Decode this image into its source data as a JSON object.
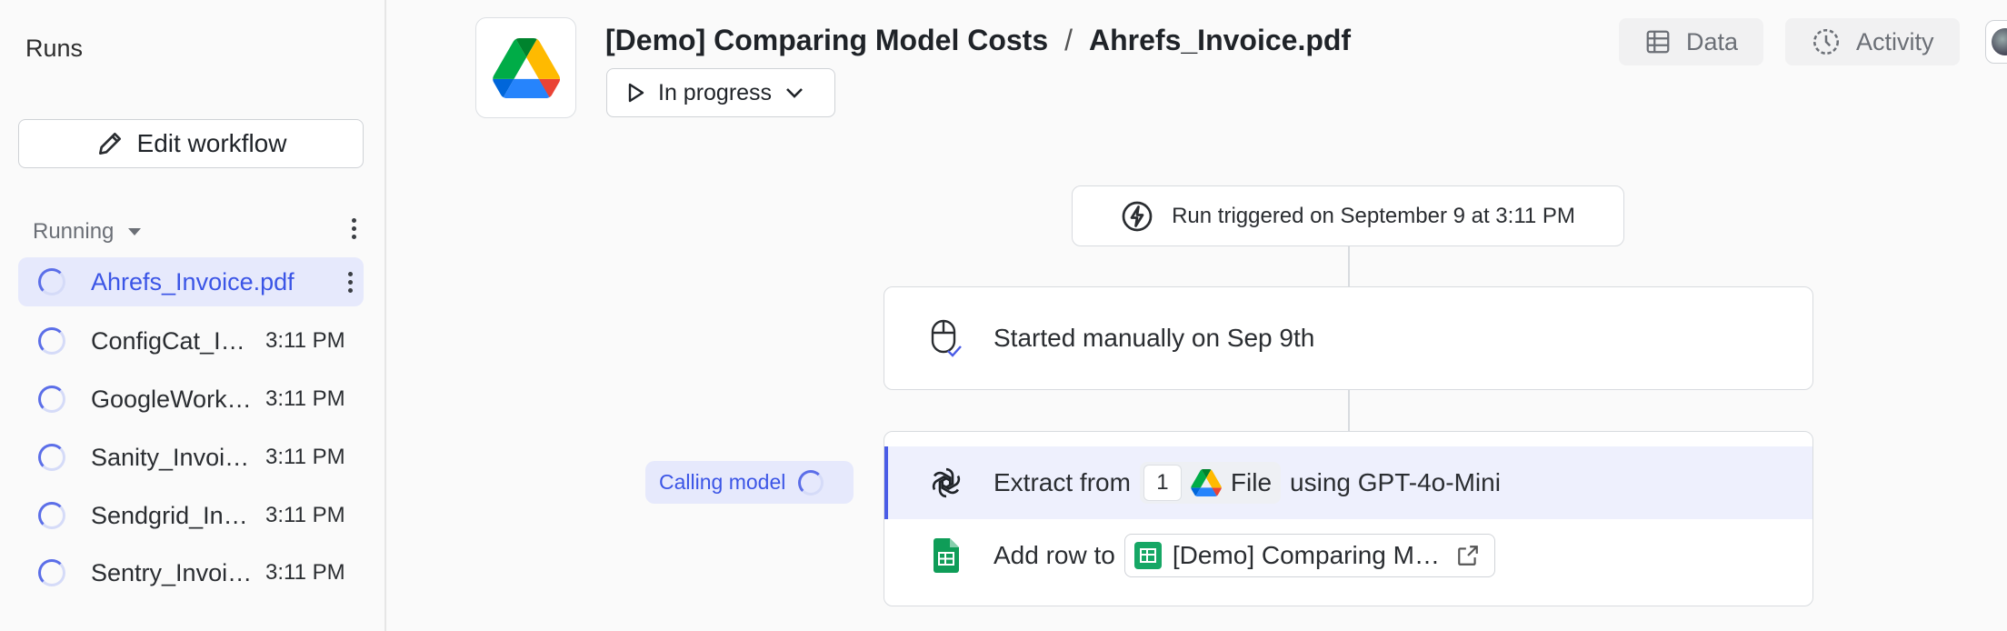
{
  "sidebar": {
    "title": "Runs",
    "edit_label": "Edit workflow",
    "group_label": "Running",
    "runs": [
      {
        "name": "Ahrefs_Invoice.pdf",
        "time": ""
      },
      {
        "name": "ConfigCat_Invoice.pdf",
        "time": "3:11 PM"
      },
      {
        "name": "GoogleWorkspace_Invoice.pdf",
        "time": "3:11 PM"
      },
      {
        "name": "Sanity_Invoice.pdf",
        "time": "3:11 PM"
      },
      {
        "name": "Sendgrid_Invoice.pdf",
        "time": "3:11 PM"
      },
      {
        "name": "Sentry_Invoice.pdf",
        "time": "3:11 PM"
      }
    ]
  },
  "header": {
    "workflow": "[Demo] Comparing Model Costs",
    "separator": "/",
    "file": "Ahrefs_Invoice.pdf",
    "status": "In progress",
    "data_label": "Data",
    "activity_label": "Activity"
  },
  "flow": {
    "trigger": "Run triggered on September 9 at 3:11 PM",
    "started": "Started manually on Sep 9th",
    "calling": "Calling model",
    "extract": {
      "prefix": "Extract from",
      "count": "1",
      "file_label": "File",
      "suffix": "using GPT-4o-Mini"
    },
    "addrow": {
      "prefix": "Add row to",
      "sheet": "[Demo] Comparing Model Costs"
    }
  }
}
